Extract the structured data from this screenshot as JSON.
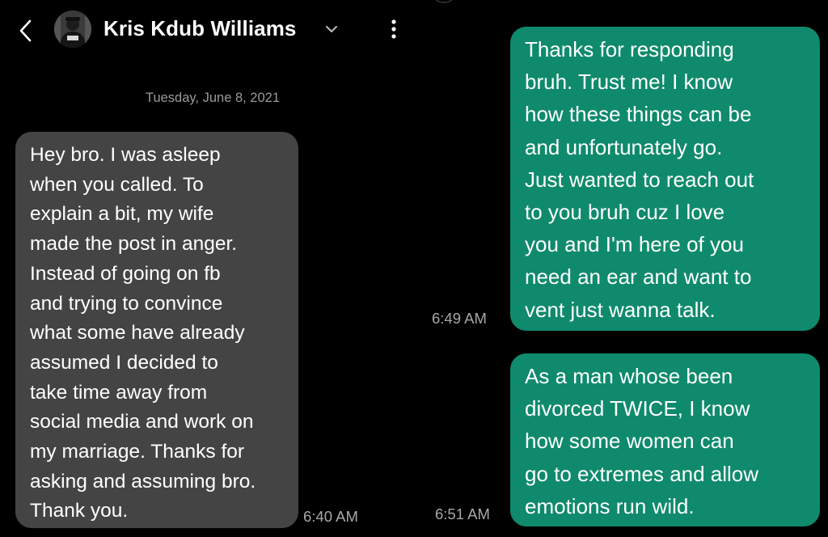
{
  "header": {
    "contact_name": "Kris Kdub Williams",
    "back_icon": "chevron-left-icon",
    "name_dropdown_icon": "chevron-down-icon",
    "more_icon": "more-vertical-icon"
  },
  "conversation": {
    "date": "Tuesday, June 8, 2021",
    "messages": [
      {
        "direction": "incoming",
        "text": "Hey bro. I was asleep\nwhen you called. To\nexplain a bit, my wife\nmade the post in anger.\nInstead of going on fb\nand trying to convince\nwhat some have already\nassumed I decided to\ntake time away from\nsocial media and work on\nmy marriage. Thanks for\nasking and assuming bro.\nThank you.",
        "time": "6:40 AM"
      },
      {
        "direction": "outgoing",
        "text": "Thanks for responding\nbruh. Trust me! I know\nhow these things can be\nand unfortunately go.\nJust wanted to reach out\nto you bruh cuz I love\nyou and I'm here of you\nneed an ear and want to\nvent just wanna talk.",
        "time": "6:49 AM"
      },
      {
        "direction": "outgoing",
        "text": "As a man whose been\ndivorced  TWICE, I know\nhow some women can\ngo to extremes and allow\nemotions run wild.",
        "time": "6:51 AM"
      }
    ]
  },
  "colors": {
    "background": "#000000",
    "incoming_bubble": "#444444",
    "outgoing_bubble": "#0f8a6c",
    "timestamp": "#a8a8a8",
    "date_separator": "#9a9a9a"
  }
}
